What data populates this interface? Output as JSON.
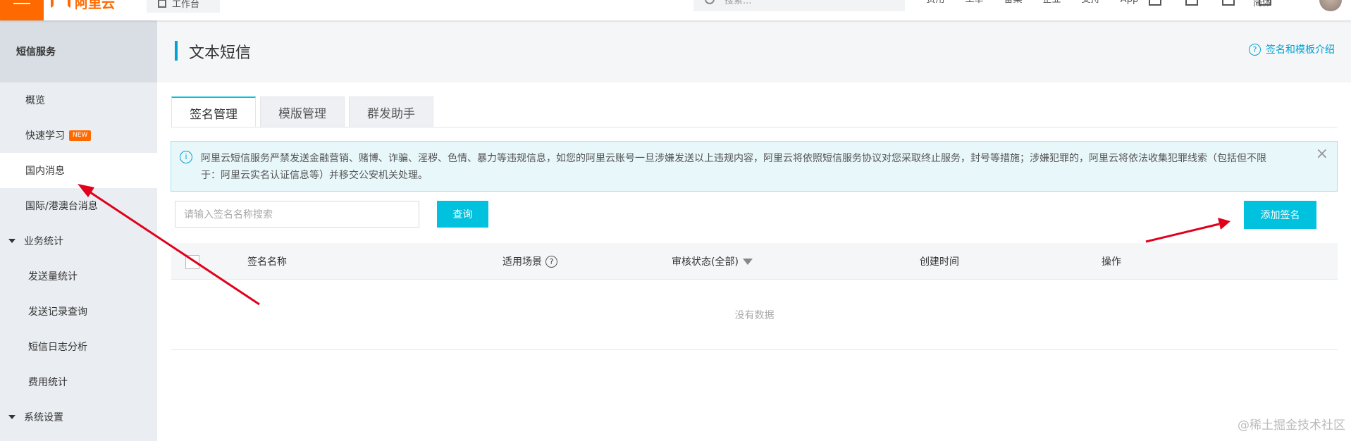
{
  "topbar": {
    "logo_text": "阿里云",
    "workbench_label": "工作台",
    "search_placeholder": "搜索...",
    "nav_items": [
      "费用",
      "工单",
      "备案",
      "企业",
      "支持",
      "App"
    ],
    "user_name": "简体"
  },
  "sidebar": {
    "header": "短信服务",
    "items": [
      {
        "label": "概览",
        "type": "item"
      },
      {
        "label": "快速学习",
        "type": "item",
        "badge": "NEW"
      },
      {
        "label": "国内消息",
        "type": "item",
        "active": true
      },
      {
        "label": "国际/港澳台消息",
        "type": "item"
      },
      {
        "label": "业务统计",
        "type": "group"
      },
      {
        "label": "发送量统计",
        "type": "sub"
      },
      {
        "label": "发送记录查询",
        "type": "sub"
      },
      {
        "label": "短信日志分析",
        "type": "sub"
      },
      {
        "label": "费用统计",
        "type": "sub"
      },
      {
        "label": "系统设置",
        "type": "group"
      }
    ]
  },
  "main": {
    "title": "文本短信",
    "help_link": "签名和模板介绍",
    "tabs": [
      {
        "label": "签名管理",
        "active": true
      },
      {
        "label": "模版管理"
      },
      {
        "label": "群发助手"
      }
    ],
    "notice": "阿里云短信服务严禁发送金融营销、赌博、诈骗、淫秽、色情、暴力等违规信息，如您的阿里云账号一旦涉嫌发送以上违规内容，阿里云将依照短信服务协议对您采取终止服务，封号等措施；涉嫌犯罪的，阿里云将依法收集犯罪线索（包括但不限于：阿里云实名认证信息等）并移交公安机关处理。",
    "search_placeholder": "请输入签名名称搜索",
    "query_button": "查询",
    "add_button": "添加签名",
    "table": {
      "columns": [
        "签名名称",
        "适用场景",
        "审核状态(全部)",
        "创建时间",
        "操作"
      ],
      "empty_text": "没有数据"
    }
  },
  "watermark": "@稀土掘金技术社区",
  "colors": {
    "accent": "#00c1de",
    "brand": "#ff6a00",
    "annotation": "#e0001b"
  }
}
